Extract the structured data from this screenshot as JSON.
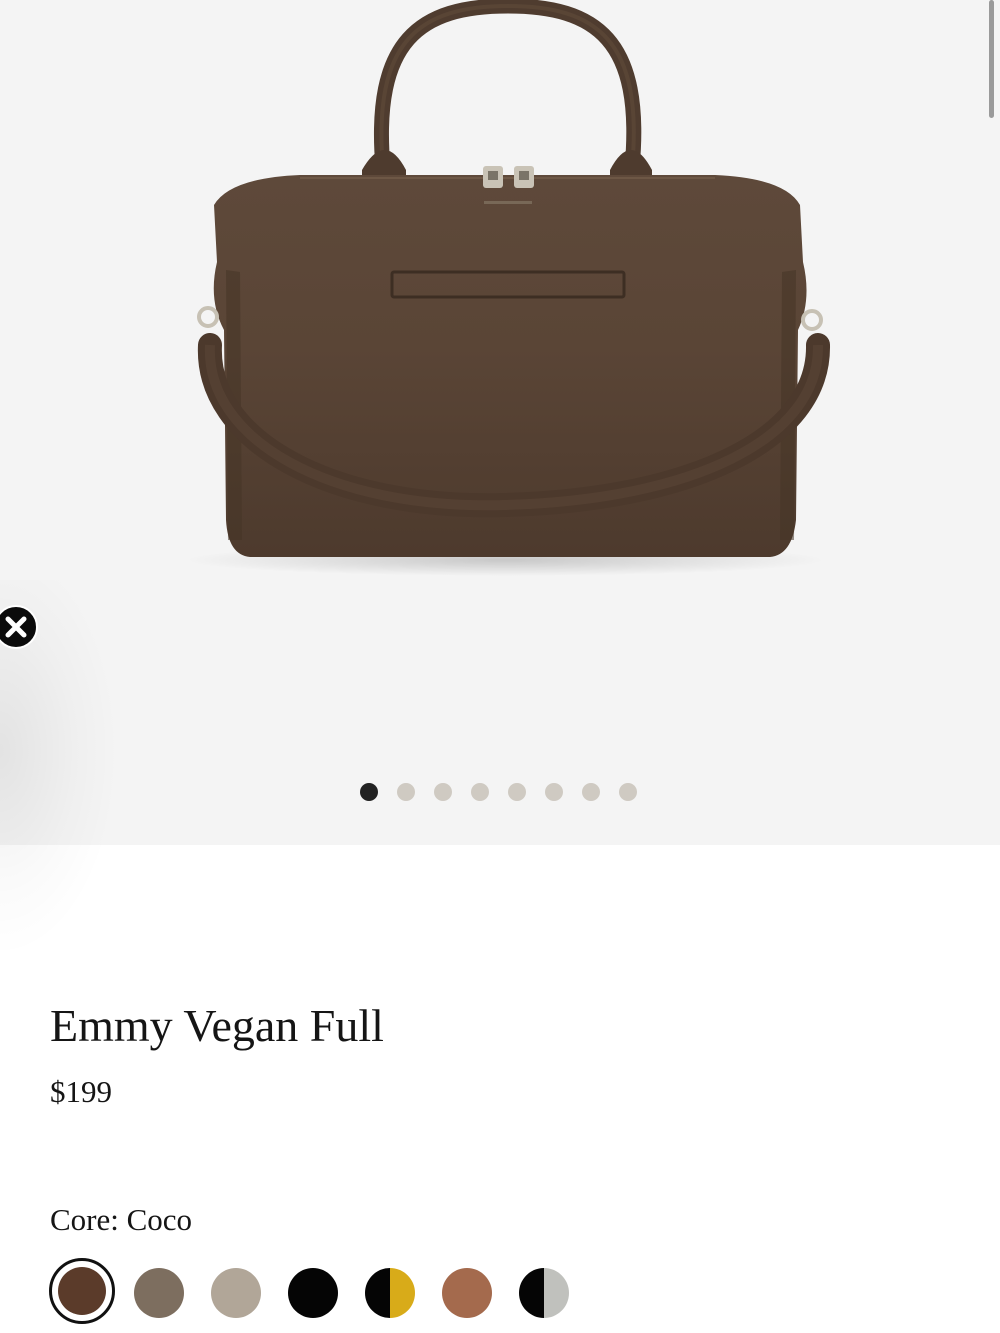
{
  "product": {
    "name": "Emmy Vegan Full",
    "price": "$199",
    "color_label": "Core: Coco"
  },
  "gallery": {
    "image_count": 8,
    "active_index": 0,
    "image_icon": "weekender-bag-image",
    "bag_color": "#5a4536"
  },
  "close": {
    "icon": "close-icon"
  },
  "swatches": [
    {
      "name": "coco",
      "color": "#5b3b2a",
      "selected": true
    },
    {
      "name": "taupe",
      "color": "#7d6e5f"
    },
    {
      "name": "sand",
      "color": "#b1a698"
    },
    {
      "name": "black",
      "color": "#050505"
    },
    {
      "name": "black-yellow",
      "left": "#050505",
      "right": "#d8ab19"
    },
    {
      "name": "caramel",
      "color": "#a46a4d"
    },
    {
      "name": "black-grey",
      "left": "#050505",
      "right": "#c0c1bd"
    }
  ]
}
